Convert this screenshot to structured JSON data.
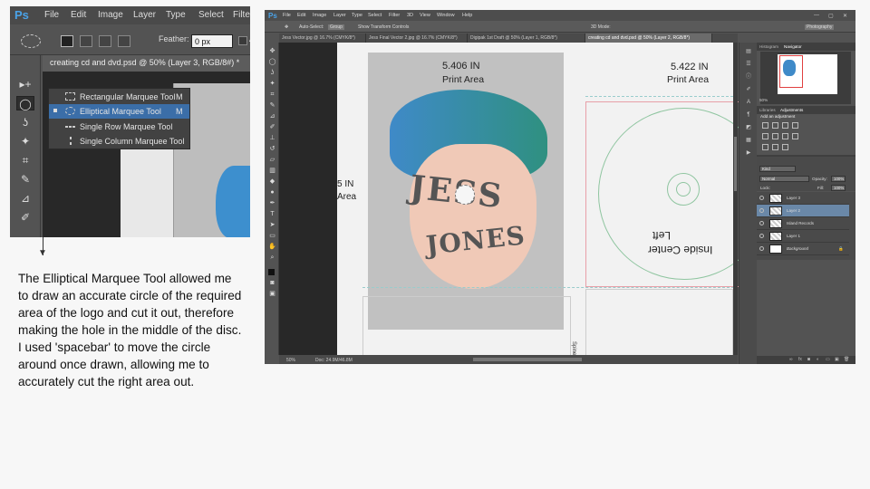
{
  "crop": {
    "logo": "Ps",
    "menu": [
      "File",
      "Edit",
      "Image",
      "Layer",
      "Type",
      "Select",
      "Filte"
    ],
    "feather_label": "Feather:",
    "feather_value": "0 px",
    "antialias": "An",
    "doc_tab": "creating cd and dvd.psd @ 50% (Layer 3, RGB/8#) *",
    "flyout": [
      {
        "label": "Rectangular Marquee Tool",
        "key": "M"
      },
      {
        "label": "Elliptical Marquee Tool",
        "key": "M"
      },
      {
        "label": "Single Row Marquee Tool",
        "key": ""
      },
      {
        "label": "Single Column Marquee Tool",
        "key": ""
      }
    ],
    "tool_glyphs": [
      "▸+",
      "◯",
      "ʖ",
      "✦",
      "⌗",
      "✎",
      "⊿",
      "✐"
    ]
  },
  "caption": "The Elliptical Marquee Tool allowed me to draw an accurate circle of the required area of the logo and cut it out, therefore making the hole in the middle of the disc. I used 'spacebar' to move the circle around once drawn, allowing me to accurately cut the right area out.",
  "app": {
    "logo": "Ps",
    "menu": [
      "File",
      "Edit",
      "Image",
      "Layer",
      "Type",
      "Select",
      "Filter",
      "3D",
      "View",
      "Window",
      "Help"
    ],
    "options": {
      "auto_select": "Auto-Select:",
      "group": "Group",
      "show_transform": "Show Transform Controls",
      "mode_3d": "3D Mode:",
      "workspace": "Photography"
    },
    "tabs": [
      "Jess Vector.jpg @ 16.7% (CMYK/8*)",
      "Jess Final Vector 2.jpg @ 16.7% (CMYK/8*)",
      "Digipak 1st Draft @ 50% (Layer 1, RGB/8*)",
      "creating cd and dvd.psd @ 50% (Layer 2, RGB/8*)"
    ],
    "canvas": {
      "size1": "5.406 IN",
      "print1": "Print Area",
      "size2": "5.422 IN",
      "print2": "Print Area",
      "side_size": "5 IN",
      "side_area": "Area",
      "jess": "JESS",
      "jones": "JONES",
      "inside_center": "Inside Center",
      "left": "Left",
      "spine": "Spine"
    },
    "status": {
      "zoom": "50%",
      "doc": "Doc: 24.9M/46.8M"
    },
    "panels": {
      "tabs_top": [
        "Histogram",
        "Navigator"
      ],
      "nav_zoom": "50%",
      "tabs_mid": [
        "Libraries",
        "Adjustments"
      ],
      "adj_title": "Add an adjustment",
      "tabs_layers": [
        "Layers",
        "Channels",
        "Paths"
      ],
      "kind": "Kind",
      "blend": "Normal",
      "opacity_label": "Opacity:",
      "opacity": "100%",
      "lock_label": "Lock:",
      "fill_label": "Fill:",
      "fill": "100%",
      "layers": [
        "Layer 3",
        "Layer 2",
        "Island Records",
        "Layer 1",
        "Background"
      ]
    }
  }
}
